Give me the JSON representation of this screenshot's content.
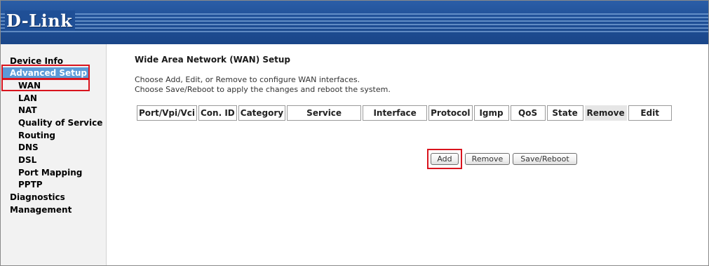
{
  "header": {
    "logo_text": "D-Link"
  },
  "sidebar": {
    "items": [
      {
        "label": "Device Info",
        "level": 1
      },
      {
        "label": "Advanced Setup",
        "level": 1,
        "active": true
      },
      {
        "label": "WAN",
        "level": 2
      },
      {
        "label": "LAN",
        "level": 2
      },
      {
        "label": "NAT",
        "level": 2
      },
      {
        "label": "Quality of Service",
        "level": 2
      },
      {
        "label": "Routing",
        "level": 2
      },
      {
        "label": "DNS",
        "level": 2
      },
      {
        "label": "DSL",
        "level": 2
      },
      {
        "label": "Port Mapping",
        "level": 2
      },
      {
        "label": "PPTP",
        "level": 2
      },
      {
        "label": "Diagnostics",
        "level": 1
      },
      {
        "label": "Management",
        "level": 1
      }
    ]
  },
  "main": {
    "title": "Wide Area Network (WAN) Setup",
    "description_line1": "Choose Add, Edit, or Remove to configure WAN interfaces.",
    "description_line2": "Choose Save/Reboot to apply the changes and reboot the system.",
    "table_headers": [
      "Port/Vpi/Vci",
      "Con. ID",
      "Category",
      "Service",
      "Interface",
      "Protocol",
      "Igmp",
      "QoS",
      "State",
      "Remove",
      "Edit"
    ],
    "buttons": {
      "add": "Add",
      "remove": "Remove",
      "save_reboot": "Save/Reboot"
    }
  },
  "colors": {
    "banner": "#1f4f96",
    "sidebar_active": "#5b9bd8",
    "highlight": "#d9141e"
  }
}
